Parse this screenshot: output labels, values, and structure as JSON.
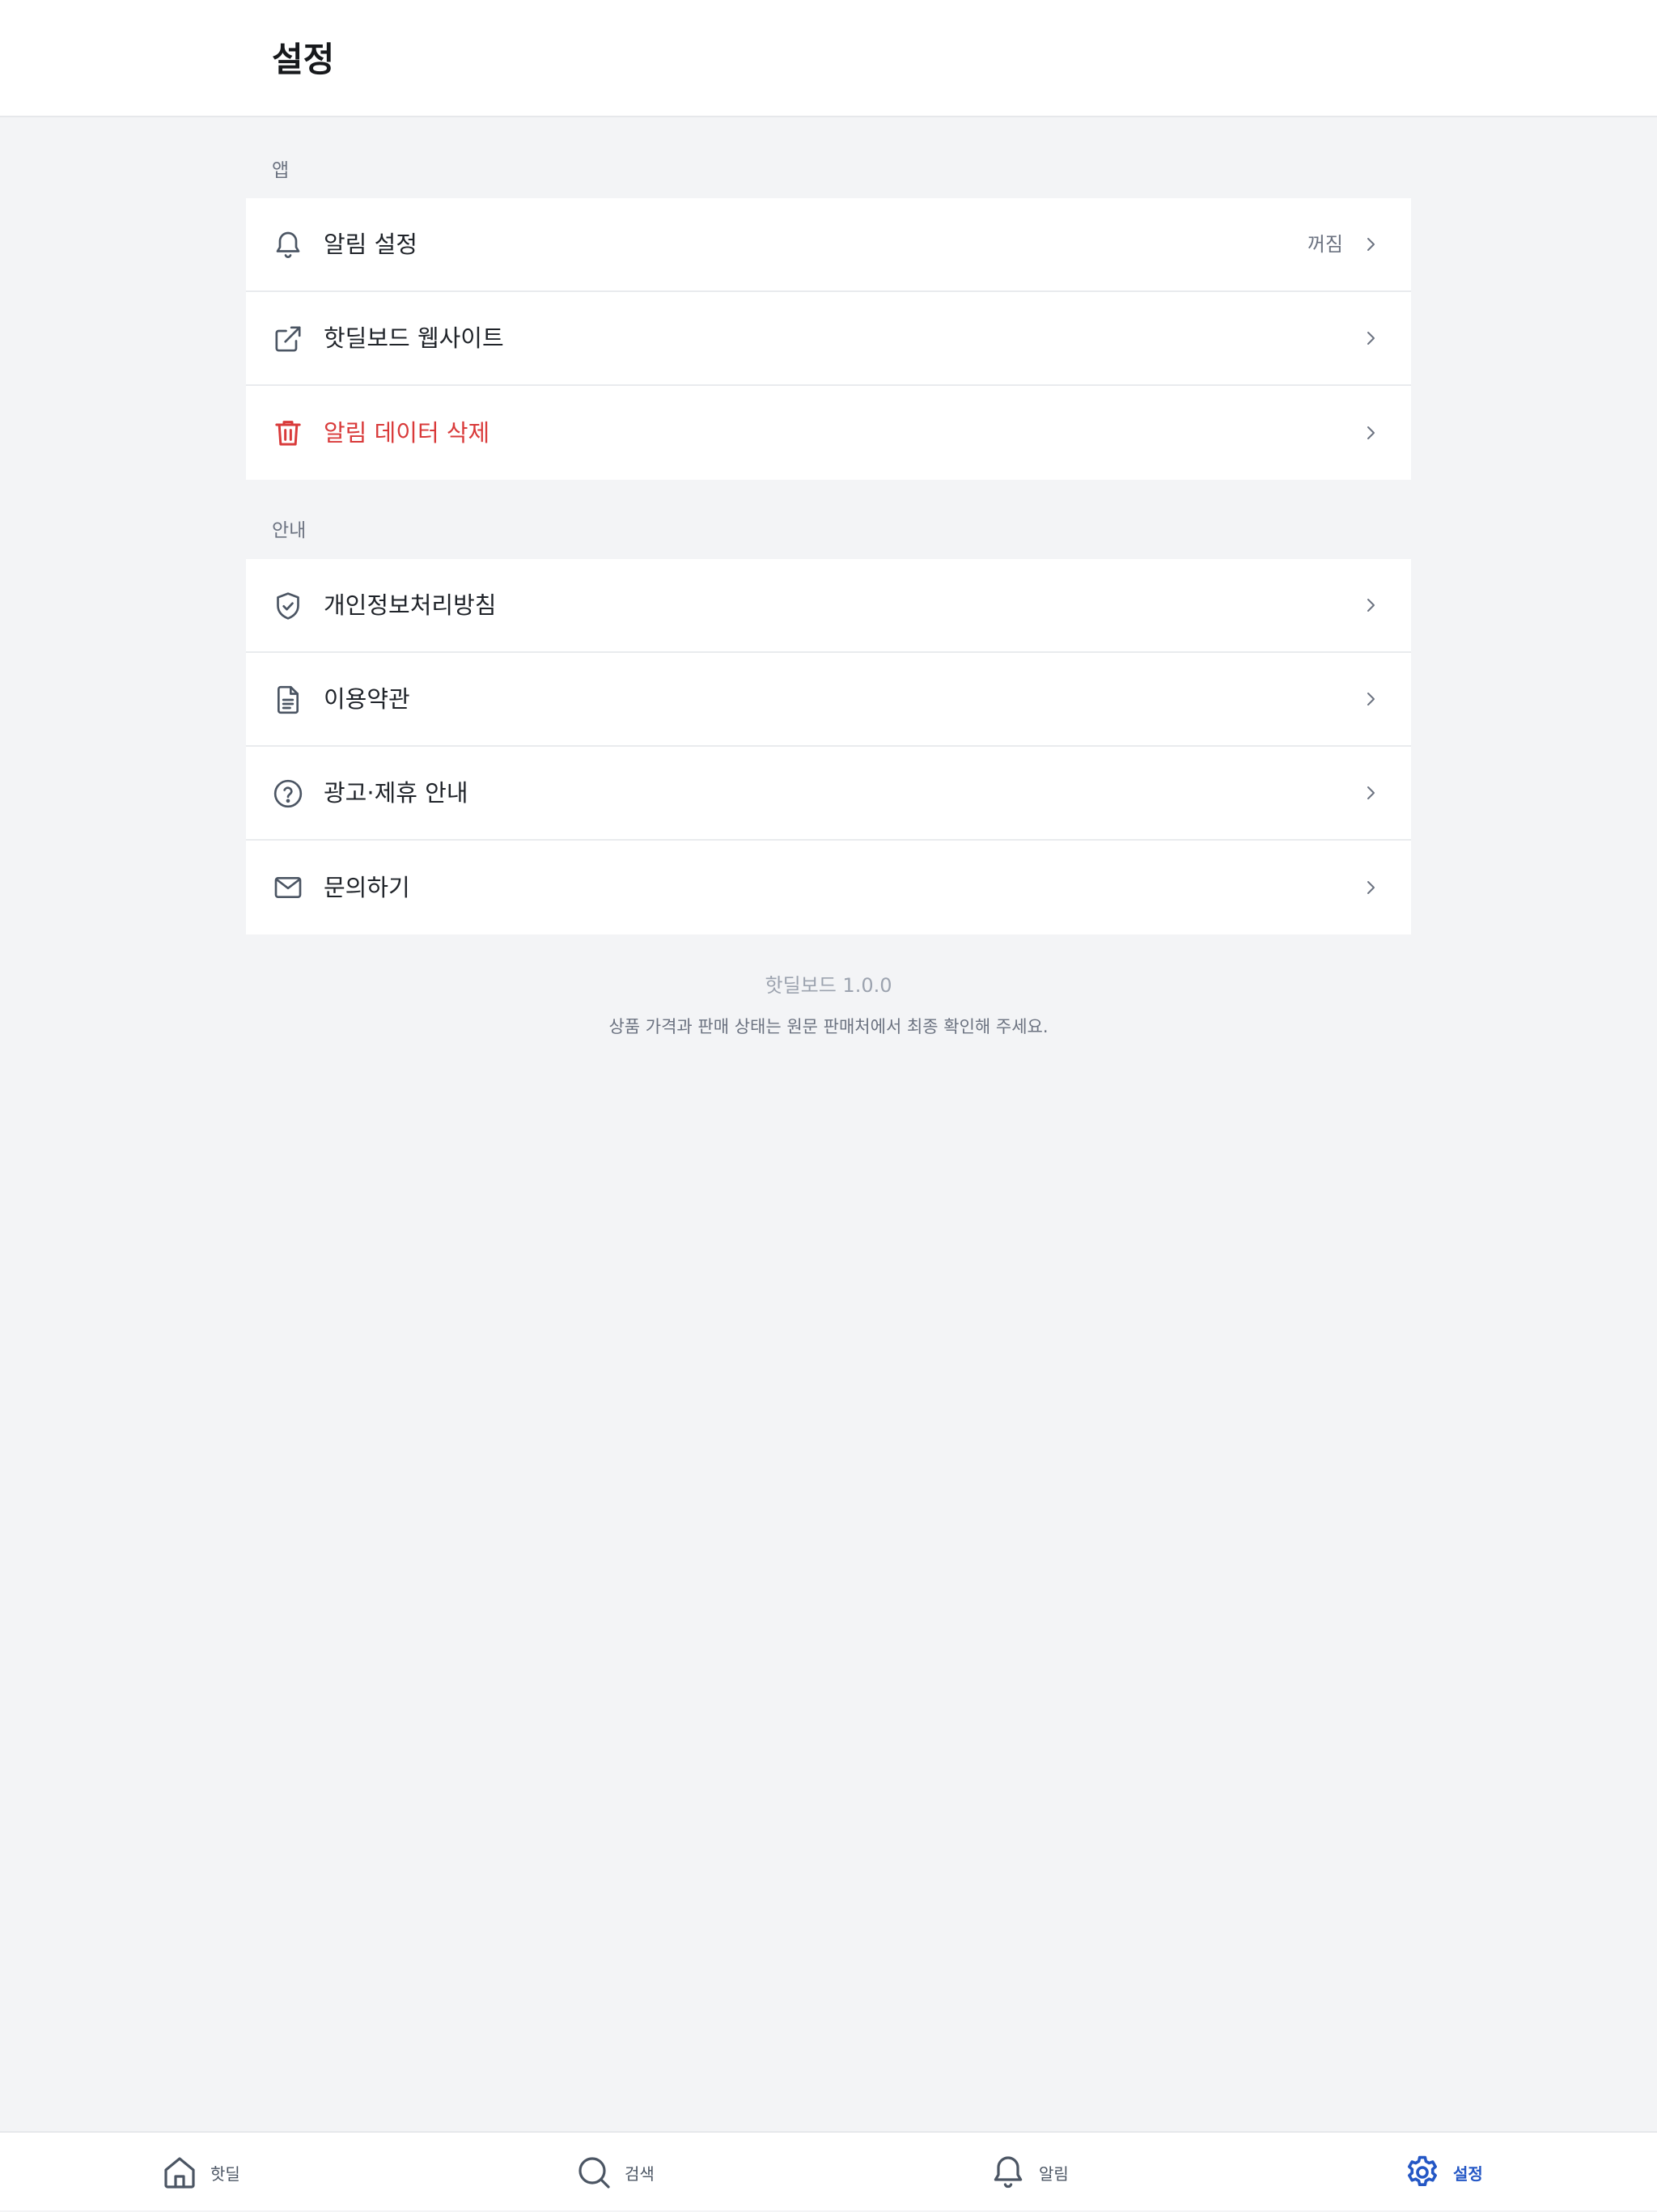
{
  "header": {
    "title": "설정"
  },
  "sections": {
    "app": {
      "label": "앱",
      "items": [
        {
          "label": "알림 설정",
          "value": "꺼짐",
          "icon": "bell-icon"
        },
        {
          "label": "핫딜보드 웹사이트",
          "icon": "external-link-icon"
        },
        {
          "label": "알림 데이터 삭제",
          "icon": "trash-icon",
          "color": "#d93a3a"
        }
      ]
    },
    "info": {
      "label": "안내",
      "items": [
        {
          "label": "개인정보처리방침",
          "icon": "shield-check-icon"
        },
        {
          "label": "이용약관",
          "icon": "document-icon"
        },
        {
          "label": "광고·제휴 안내",
          "icon": "question-circle-icon"
        },
        {
          "label": "문의하기",
          "icon": "mail-icon"
        }
      ]
    }
  },
  "footer": {
    "version": "핫딜보드 1.0.0",
    "note": "상품 가격과 판매 상태는 원문 판매처에서 최종 확인해 주세요."
  },
  "tabbar": {
    "tabs": [
      {
        "label": "핫딜",
        "icon": "home-icon"
      },
      {
        "label": "검색",
        "icon": "search-icon"
      },
      {
        "label": "알림",
        "icon": "bell-icon"
      },
      {
        "label": "설정",
        "icon": "gear-icon",
        "active": true
      }
    ]
  },
  "colors": {
    "accent": "#2457c5",
    "danger": "#d93a3a",
    "background": "#f3f4f6"
  }
}
